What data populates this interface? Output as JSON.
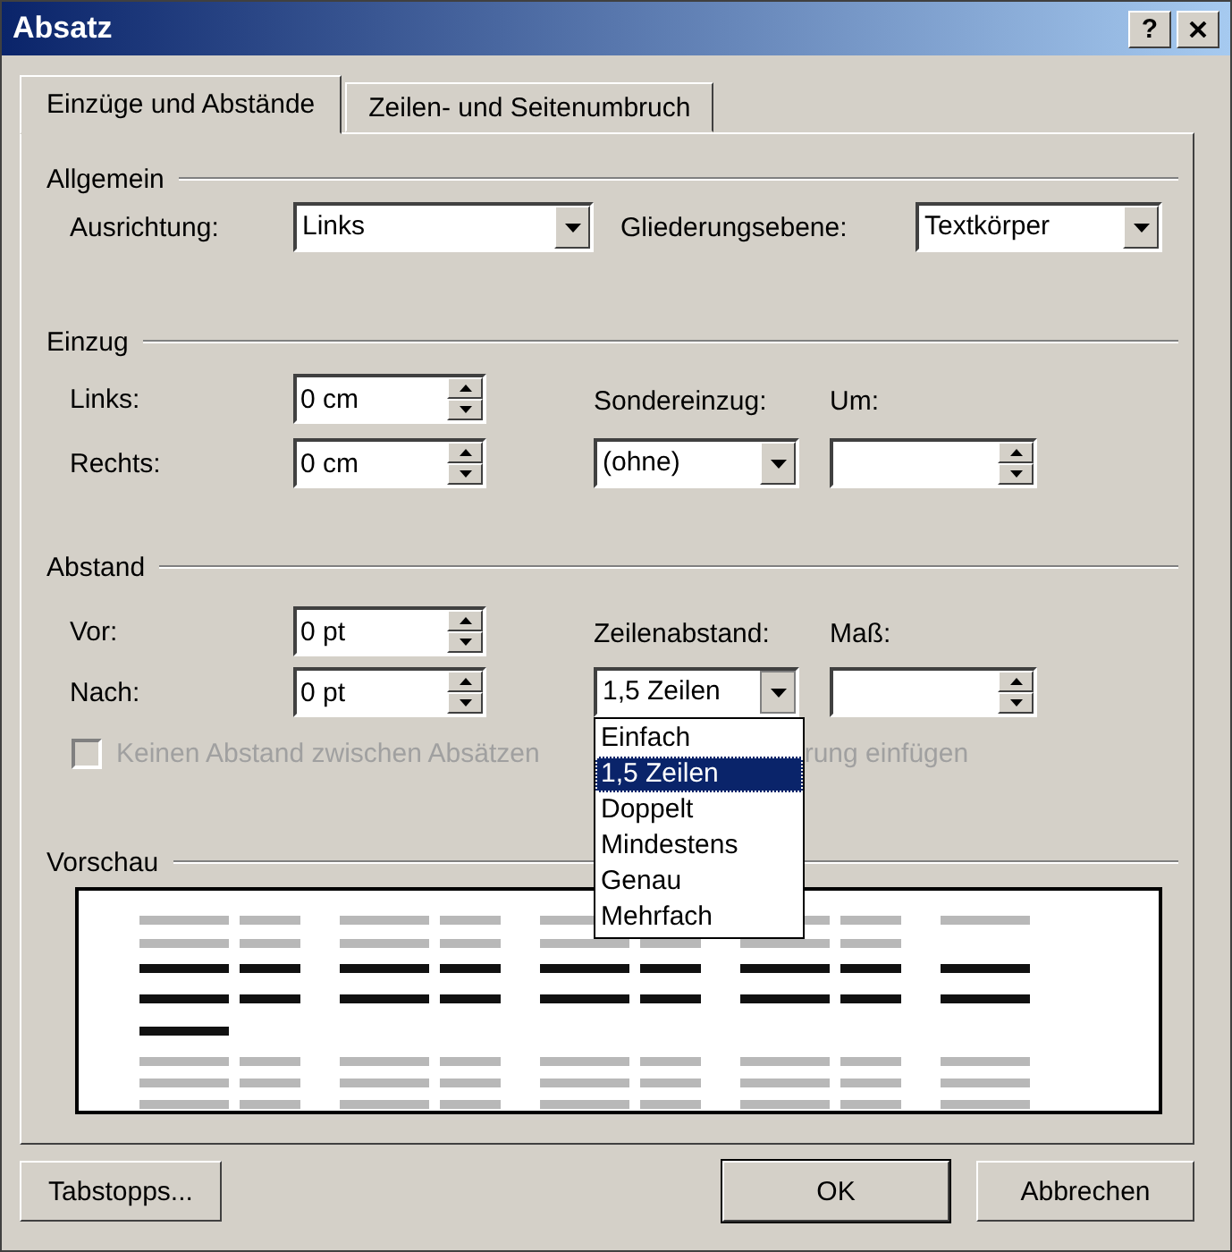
{
  "window": {
    "title": "Absatz",
    "help_button": "?"
  },
  "tabs": [
    {
      "label": "Einzüge und Abstände",
      "selected": true
    },
    {
      "label": "Zeilen- und Seitenumbruch",
      "selected": false
    }
  ],
  "general": {
    "heading": "Allgemein",
    "alignment": {
      "label": "Ausrichtung:",
      "value": "Links"
    },
    "outline_level": {
      "label": "Gliederungsebene:",
      "value": "Textkörper"
    }
  },
  "indent": {
    "heading": "Einzug",
    "left": {
      "label": "Links:",
      "value": "0 cm"
    },
    "right": {
      "label": "Rechts:",
      "value": "0 cm"
    },
    "special": {
      "label": "Sondereinzug:",
      "value": "(ohne)"
    },
    "by": {
      "label": "Um:"
    }
  },
  "spacing": {
    "heading": "Abstand",
    "before": {
      "label": "Vor:",
      "value": "0 pt"
    },
    "after": {
      "label": "Nach:",
      "value": "0 pt"
    },
    "at": {
      "label": "Maß:"
    },
    "line_spacing": {
      "label": "Zeilenabstand:",
      "value": "1,5 Zeilen",
      "expanded": true,
      "options": [
        {
          "label": "Einfach",
          "selected": false
        },
        {
          "label": "1,5 Zeilen",
          "selected": true
        },
        {
          "label": "Doppelt",
          "selected": false
        },
        {
          "label": "Mindestens",
          "selected": false
        },
        {
          "label": "Genau",
          "selected": false
        },
        {
          "label": "Mehrfach",
          "selected": false
        }
      ]
    },
    "no_space": {
      "label_start": "Keinen Abstand zwischen Absätzen",
      "label_end": "rung einfügen",
      "checked": false,
      "disabled": true
    }
  },
  "preview": {
    "heading": "Vorschau"
  },
  "buttons": {
    "tabstops": "Tabstopps...",
    "ok": "OK",
    "cancel": "Abbrechen"
  }
}
